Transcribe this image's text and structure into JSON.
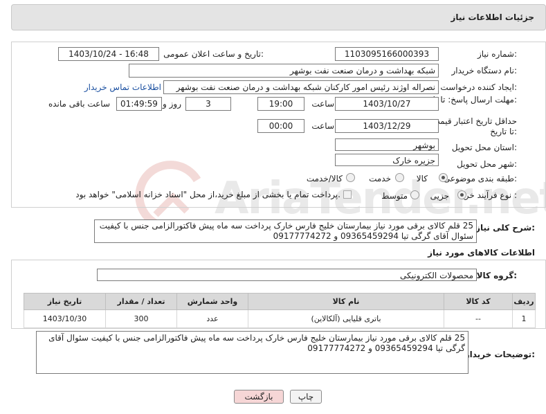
{
  "header": {
    "title": "جزئیات اطلاعات نیاز"
  },
  "watermark": {
    "text": "AriaTender.net"
  },
  "form": {
    "need_number_label": "شماره نیاز:",
    "need_number": "1103095166000393",
    "announce_label": "تاریخ و ساعت اعلان عمومی:",
    "announce_value": "1403/10/24 - 16:48",
    "buyer_org_label": "نام دستگاه خریدار:",
    "buyer_org": "شبکه بهداشت و درمان صنعت نفت بوشهر",
    "requester_label": "ایجاد کننده درخواست:",
    "requester": "نصراله اوژند رئیس امور کارکنان شبکه بهداشت و درمان صنعت نفت بوشهر",
    "contact_link": "اطلاعات تماس خریدار",
    "deadline_label": "مهلت ارسال پاسخ: تا تاریخ:",
    "deadline_date": "1403/10/27",
    "time_label": "ساعت",
    "deadline_time": "19:00",
    "days_value": "3",
    "days_label": "روز و",
    "remaining_time": "01:49:59",
    "remaining_label": "ساعت باقی مانده",
    "validity_label": "حداقل تاریخ اعتبار قیمت: تا تاریخ:",
    "validity_date": "1403/12/29",
    "validity_time_label": "ساعت",
    "validity_time": "00:00",
    "province_label": "استان محل تحویل:",
    "province": "بوشهر",
    "city_label": "شهر محل تحویل:",
    "city": "جزیره خارک",
    "category_label": "طبقه بندی موضوعی:",
    "category_options": [
      "کالا",
      "خدمت",
      "کالا/خدمت"
    ],
    "process_label": "نوع فرآیند خرید :",
    "process_options": [
      "جزیی",
      "متوسط"
    ],
    "payment_note": "پرداخت تمام یا بخشی از مبلغ خرید،از محل \"اسناد خزانه اسلامی\" خواهد بود."
  },
  "description": {
    "label": "شرح کلی نیاز:",
    "text": "25 قلم کالای برقی مورد نیاز بیمارستان خلیج فارس خارک پرداخت سه ماه پیش فاکتورالزامی جنس با کیفیت سئوال آقای گرگی تیا 09365459294 و 09177774272"
  },
  "goods": {
    "section_title": "اطلاعات کالاهای مورد نیاز",
    "group_label": "گروه کالا:",
    "group_value": "محصولات الکترونیکی",
    "columns": [
      "ردیف",
      "کد کالا",
      "نام کالا",
      "واحد شمارش",
      "تعداد / مقدار",
      "تاریخ نیاز"
    ],
    "rows": [
      [
        "1",
        "--",
        "باتری قلیایی (آلکالاین)",
        "عدد",
        "300",
        "1403/10/30"
      ]
    ]
  },
  "buyer_notes": {
    "label": "توضیحات خریدار:",
    "text": "25 قلم کالای برقی مورد نیاز بیمارستان خلیج فارس خارک پرداخت سه ماه پیش فاکتورالزامی جنس با کیفیت سئوال آقای گرگی تیا 09365459294 و 09177774272"
  },
  "buttons": {
    "print": "چاپ",
    "back": "بازگشت"
  },
  "colors": {
    "header_bg": "#e4e4e4",
    "link": "#1a4fa0",
    "back_button": "#f6d6d6",
    "table_header": "#d9d9d9"
  }
}
